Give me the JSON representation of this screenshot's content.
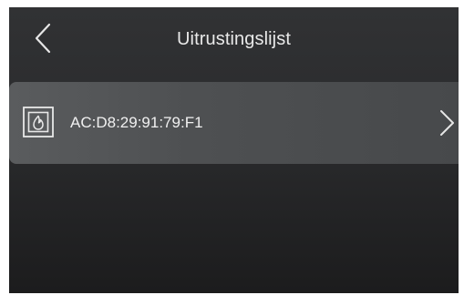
{
  "header": {
    "title": "Uitrustingslijst",
    "back_icon": "chevron-left-icon"
  },
  "device_list": [
    {
      "name": "AC:D8:29:91:79:F1",
      "icon": "fireplace-icon",
      "chevron_icon": "chevron-right-icon"
    }
  ],
  "colors": {
    "background_top": "#313234",
    "background_bottom": "#1c1c1d",
    "row_background": "#505254",
    "text": "#f0f0f0",
    "icon": "#e8e8e8"
  }
}
